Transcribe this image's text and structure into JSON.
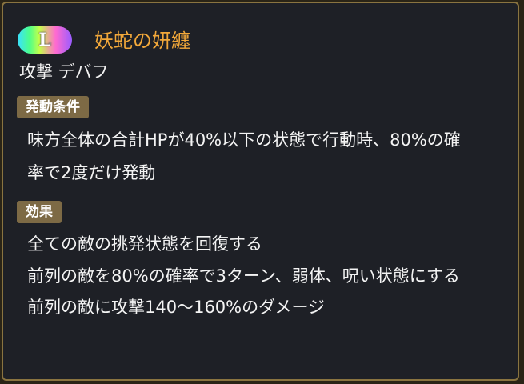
{
  "skill": {
    "rarity_badge": "L",
    "name": "妖蛇の妍纏",
    "category": "攻撃 デバフ"
  },
  "trigger": {
    "label": "発動条件",
    "lines": [
      "味方全体の合計HPが40%以下の状態で行動時、80%の確",
      "率で2度だけ発動"
    ]
  },
  "effect": {
    "label": "効果",
    "lines": [
      "全ての敵の挑発状態を回復する",
      "前列の敵を80%の確率で3ターン、弱体、呪い状態にする",
      "前列の敵に攻撃140〜160%のダメージ"
    ]
  },
  "colors": {
    "title": "#f2a83a",
    "panel_bg": "#1e2026",
    "panel_border": "#8a7440",
    "section_label_bg": "#7d6a45"
  }
}
